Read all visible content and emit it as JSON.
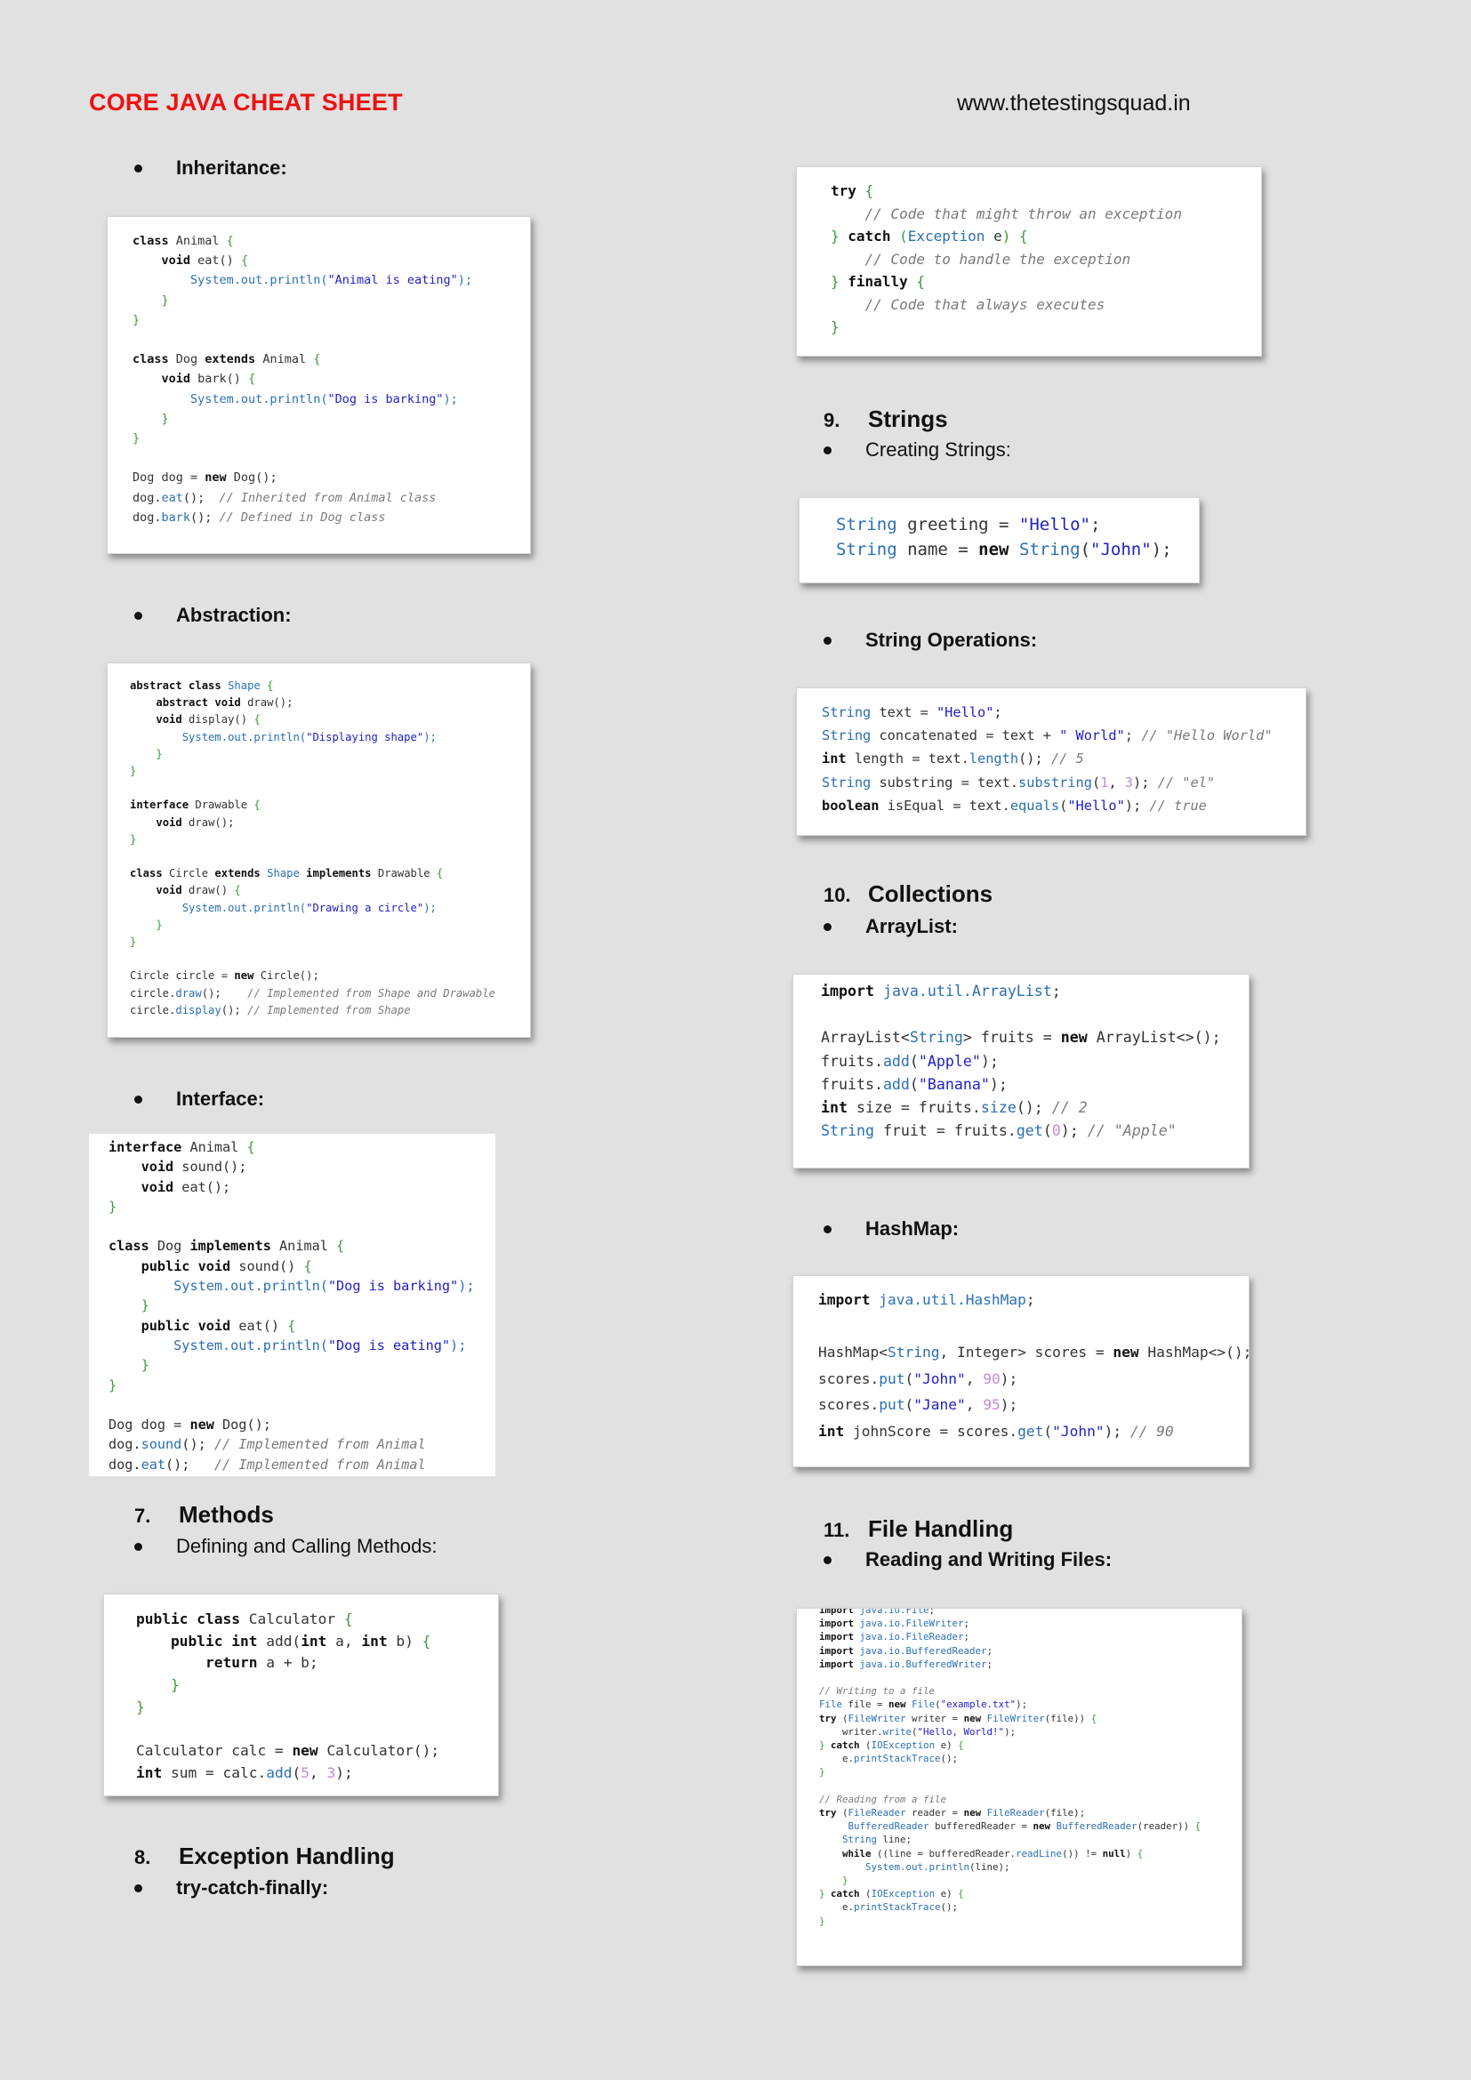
{
  "header": {
    "title": "CORE JAVA CHEAT SHEET",
    "website": "www.thetestingsquad.in"
  },
  "left": {
    "inheritance_label": "Inheritance:",
    "abstraction_label": "Abstraction:",
    "interface_label": "Interface:",
    "methods": {
      "number": "7.",
      "title": "Methods",
      "sub": "Defining and Calling Methods:"
    },
    "exceptions": {
      "number": "8.",
      "title": "Exception Handling",
      "sub": "try-catch-finally:"
    }
  },
  "right": {
    "strings": {
      "number": "9.",
      "title": "Strings",
      "sub": "Creating Strings:",
      "ops_label": "String Operations:"
    },
    "collections": {
      "number": "10.",
      "title": "Collections",
      "arraylist_label": "ArrayList:",
      "hashmap_label": "HashMap:"
    },
    "files": {
      "number": "11.",
      "title": "File Handling",
      "sub": "Reading and Writing Files:"
    }
  }
}
